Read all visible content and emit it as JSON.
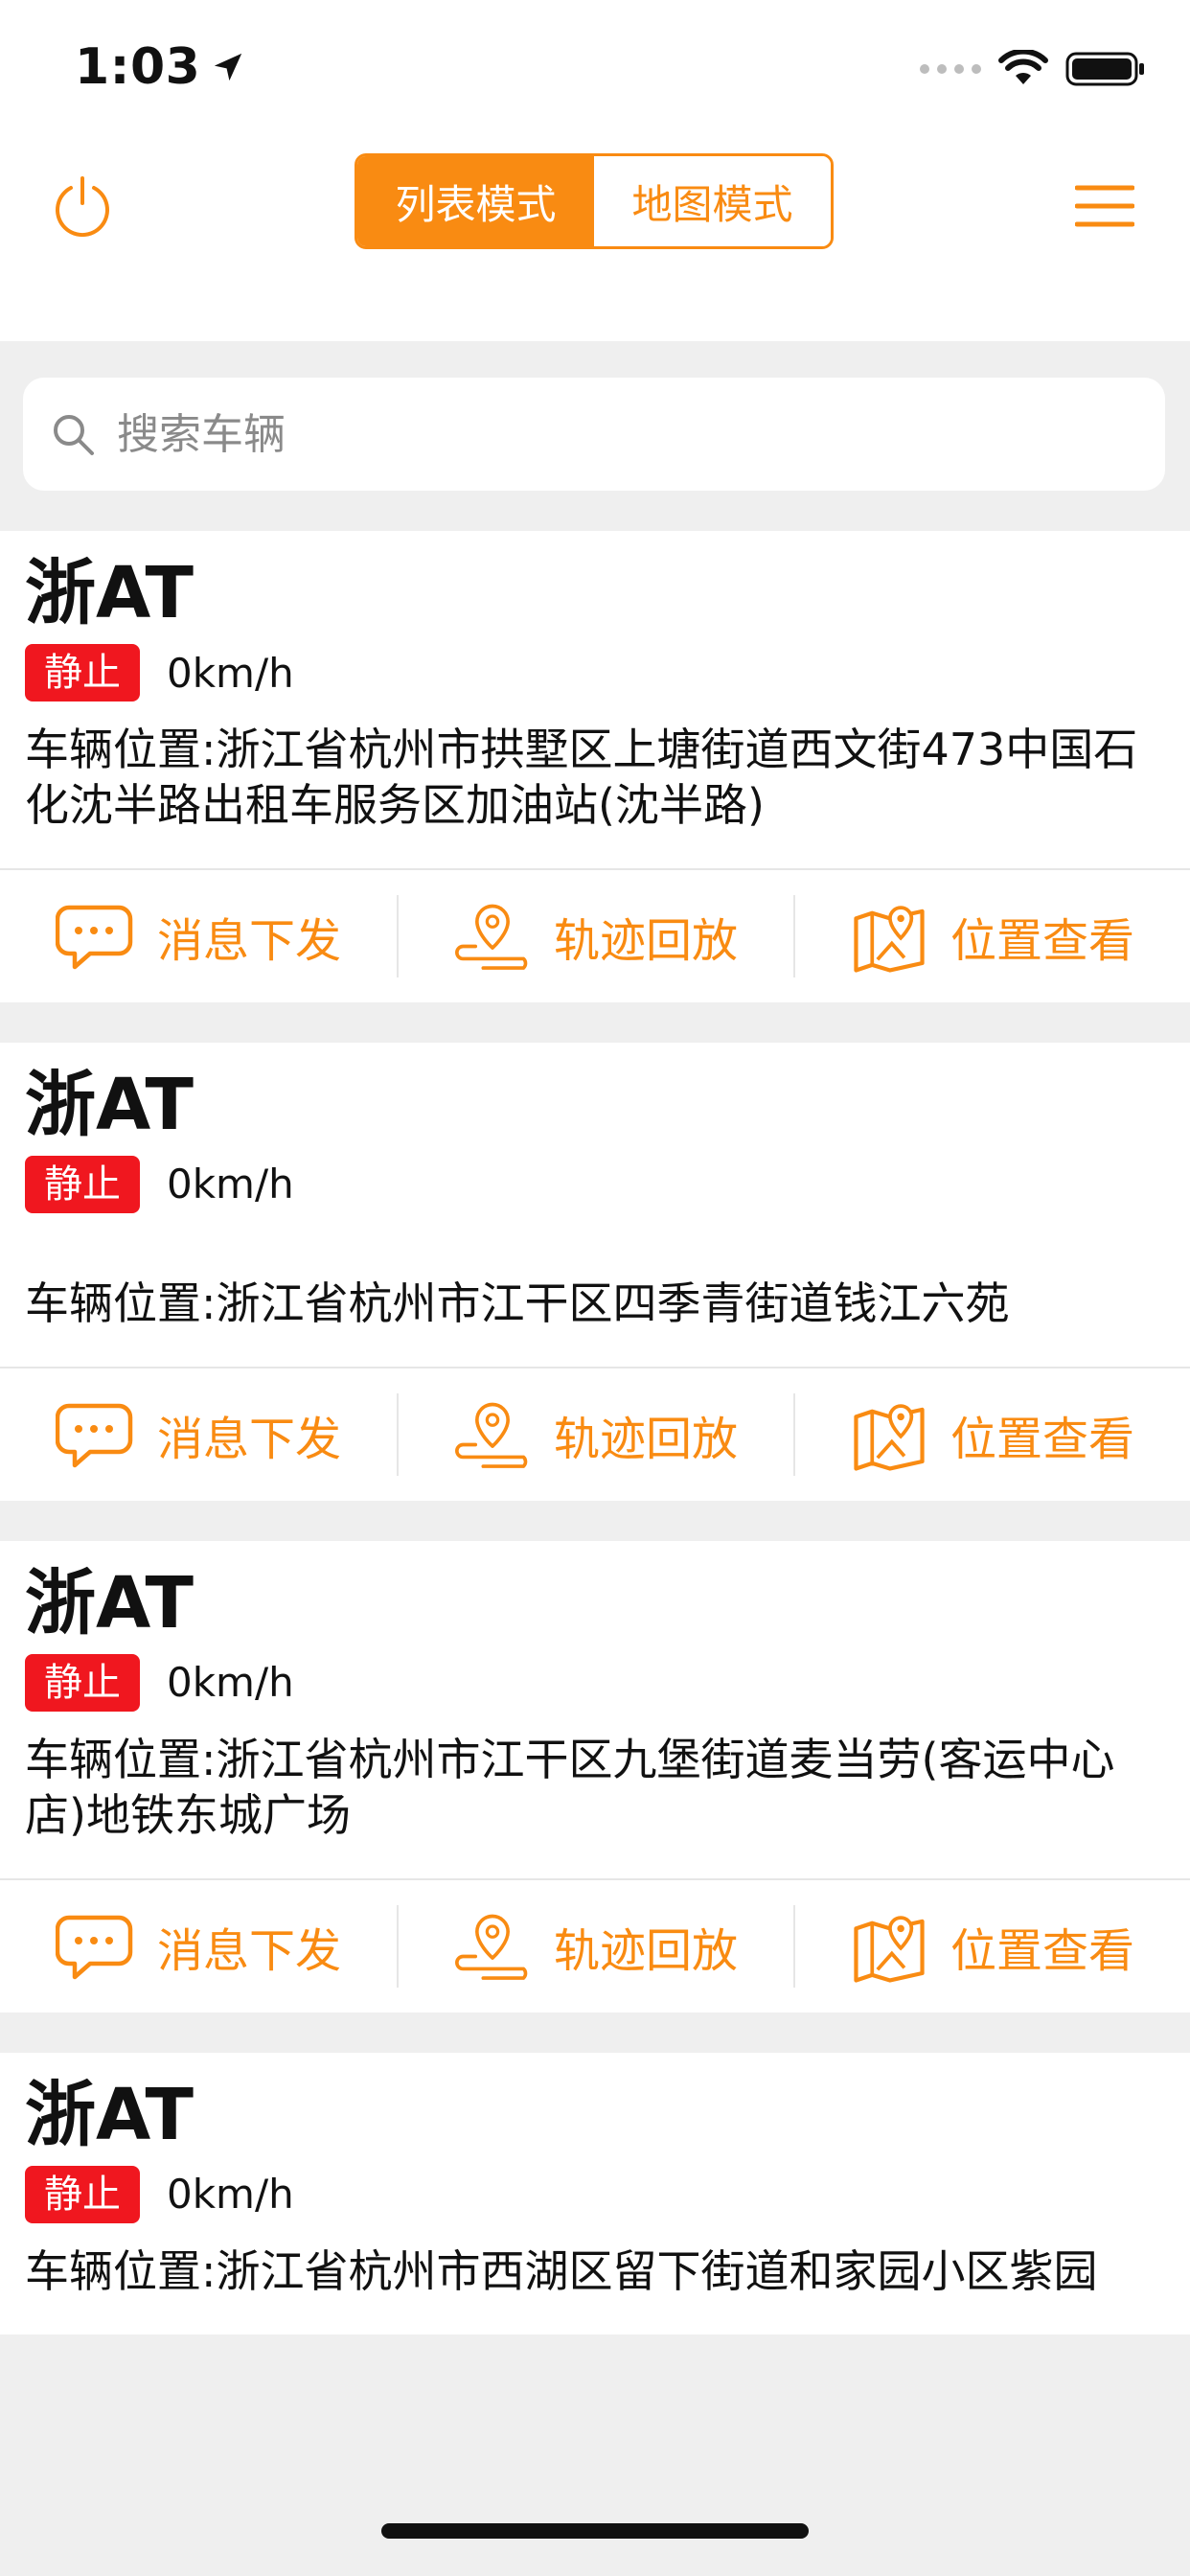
{
  "status_bar": {
    "time": "1:03"
  },
  "header": {
    "modes": [
      {
        "label": "列表模式",
        "active": true
      },
      {
        "label": "地图模式",
        "active": false
      }
    ]
  },
  "search": {
    "placeholder": "搜索车辆",
    "value": ""
  },
  "actions": {
    "message": "消息下发",
    "track": "轨迹回放",
    "location": "位置查看"
  },
  "vehicles": [
    {
      "plate": "浙AT",
      "status": "静止",
      "speed": "0km/h",
      "address": "车辆位置:浙江省杭州市拱墅区上塘街道西文街473中国石化沈半路出租车服务区加油站(沈半路)"
    },
    {
      "plate": "浙AT",
      "status": "静止",
      "speed": "0km/h",
      "address": "车辆位置:浙江省杭州市江干区四季青街道钱江六苑"
    },
    {
      "plate": "浙AT",
      "status": "静止",
      "speed": "0km/h",
      "address": "车辆位置:浙江省杭州市江干区九堡街道麦当劳(客运中心店)地铁东城广场"
    },
    {
      "plate": "浙AT",
      "status": "静止",
      "speed": "0km/h",
      "address": "车辆位置:浙江省杭州市西湖区留下街道和家园小区紫园"
    }
  ],
  "colors": {
    "accent": "#F98B12",
    "status_red": "#F0171F",
    "background": "#EFEFEF"
  },
  "icons": {
    "power": "power-icon",
    "menu": "hamburger-menu-icon",
    "search": "search-icon",
    "message": "chat-bubble-icon",
    "track": "map-pin-route-icon",
    "location": "map-location-icon"
  }
}
